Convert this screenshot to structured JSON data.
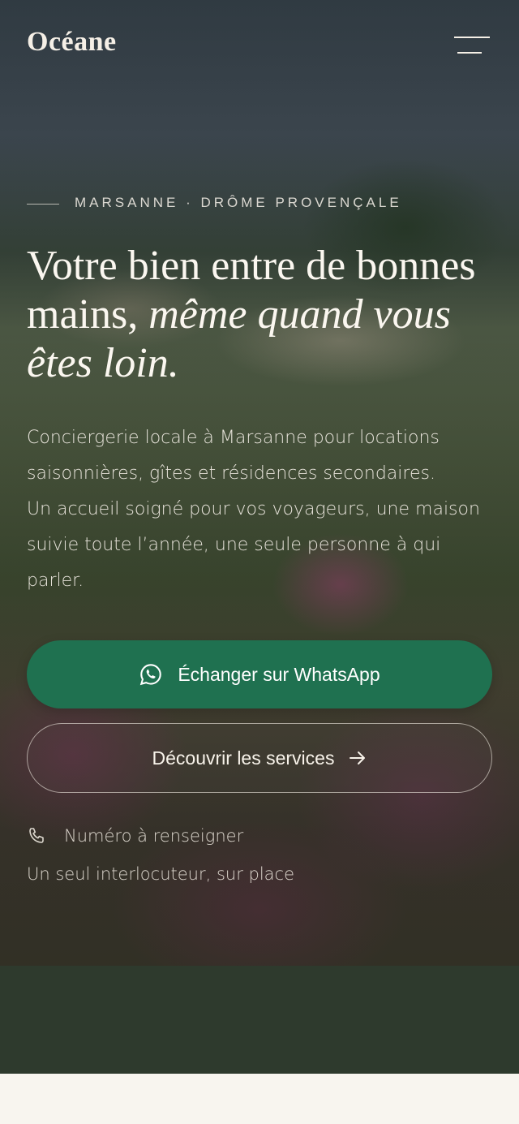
{
  "header": {
    "brand": "Océane",
    "menu_icon": "menu-icon"
  },
  "hero": {
    "kicker": "MARSANNE · DRÔME PROVENÇALE",
    "headline_plain": "Votre bien entre de bonnes mains, ",
    "headline_italic": "même quand vous êtes loin.",
    "intro_line_1": "Conciergerie locale à Marsanne pour locations saisonnières, gîtes et résidences secondaires.",
    "intro_line_2": "Un accueil soigné pour vos voyageurs, une maison suivie toute l’année, une seule personne à qui parler.",
    "whatsapp_label": "Échanger sur WhatsApp",
    "whatsapp_icon": "whatsapp-icon",
    "services_label": "Découvrir les services",
    "services_icon": "arrow-right-icon",
    "phone_icon": "phone-icon",
    "phone_text": "Numéro à renseigner",
    "contact_note": "Un seul interlocuteur, sur place"
  },
  "colors": {
    "whatsapp_green": "#1f7150",
    "dark_band": "#2e3a2d",
    "light_band": "#f8f5ef",
    "text_light": "#fbf7f0"
  }
}
